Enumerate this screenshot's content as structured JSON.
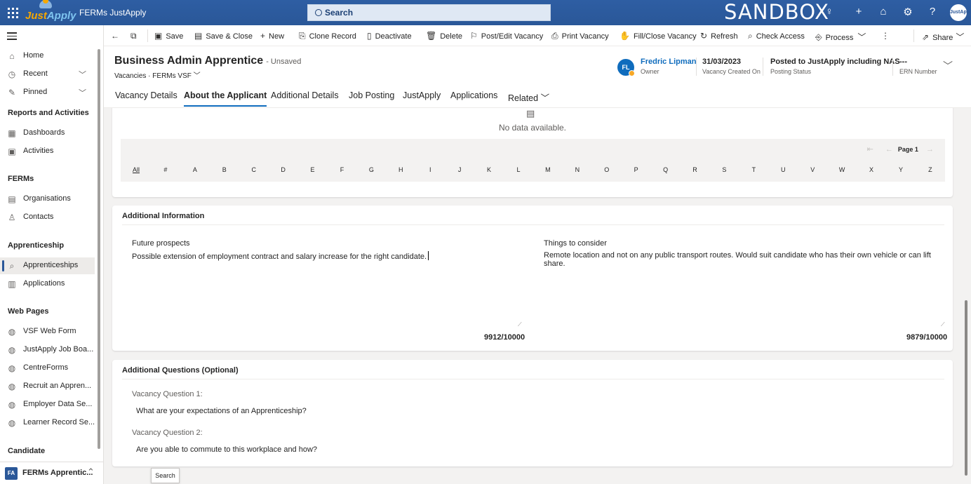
{
  "topbar": {
    "logo_text_main": "Just",
    "logo_text_accent": "Apply",
    "app_name": "FERMs JustApply",
    "search_label": "Search",
    "environment": "SANDBOX",
    "avatar_text": "JustApply"
  },
  "sidebar": {
    "items_top": [
      {
        "label": "Home",
        "icon": "home-icon"
      },
      {
        "label": "Recent",
        "icon": "clock-icon"
      },
      {
        "label": "Pinned",
        "icon": "pin-icon"
      }
    ],
    "section_reports": "Reports and Activities",
    "reports_items": [
      {
        "label": "Dashboards",
        "icon": "dashboard-icon"
      },
      {
        "label": "Activities",
        "icon": "activities-icon"
      }
    ],
    "section_ferms": "FERMs",
    "ferms_items": [
      {
        "label": "Organisations",
        "icon": "organisation-icon"
      },
      {
        "label": "Contacts",
        "icon": "contact-icon"
      }
    ],
    "section_apprenticeship": "Apprenticeship",
    "apprenticeship_items": [
      {
        "label": "Apprenticeships",
        "icon": "search-doc-icon"
      },
      {
        "label": "Applications",
        "icon": "form-icon"
      }
    ],
    "section_web": "Web Pages",
    "web_items": [
      {
        "label": "VSF Web Form"
      },
      {
        "label": "JustApply Job Boa..."
      },
      {
        "label": "CentreForms"
      },
      {
        "label": "Recruit an Appren..."
      },
      {
        "label": "Employer Data Se..."
      },
      {
        "label": "Learner Record Se..."
      }
    ],
    "section_candidate": "Candidate",
    "area_badge": "FA",
    "area_label": "FERMs Apprentic..."
  },
  "commands": {
    "save": "Save",
    "save_close": "Save & Close",
    "new": "New",
    "clone": "Clone Record",
    "deactivate": "Deactivate",
    "delete": "Delete",
    "post_edit": "Post/Edit Vacancy",
    "print": "Print Vacancy",
    "fill_close": "Fill/Close Vacancy",
    "refresh": "Refresh",
    "check_access": "Check Access",
    "process": "Process",
    "share": "Share"
  },
  "header": {
    "title": "Business Admin Apprentice",
    "status": "- Unsaved",
    "entity": "Vacancies",
    "form": "FERMs VSF",
    "owner_initials": "FL",
    "owner_name": "Fredric Lipman",
    "owner_label": "Owner",
    "created_value": "31/03/2023",
    "created_label": "Vacancy Created On",
    "posting_value": "Posted to JustApply including NAS",
    "posting_label": "Posting Status",
    "ern_value": "---",
    "ern_label": "ERN Number"
  },
  "tabs": [
    {
      "label": "Vacancy Details"
    },
    {
      "label": "About the Applicant"
    },
    {
      "label": "Additional Details"
    },
    {
      "label": "Job Posting"
    },
    {
      "label": "JustApply"
    },
    {
      "label": "Applications"
    },
    {
      "label": "Related"
    }
  ],
  "grid": {
    "empty_text": "No data available.",
    "page_label": "Page 1",
    "alphabet": [
      "All",
      "#",
      "A",
      "B",
      "C",
      "D",
      "E",
      "F",
      "G",
      "H",
      "I",
      "J",
      "K",
      "L",
      "M",
      "N",
      "O",
      "P",
      "Q",
      "R",
      "S",
      "T",
      "U",
      "V",
      "W",
      "X",
      "Y",
      "Z"
    ]
  },
  "additional_info": {
    "title": "Additional Information",
    "future_label": "Future prospects",
    "future_value": "Possible extension of employment contract and salary increase for the right candidate.",
    "future_counter": "9912/10000",
    "consider_label": "Things to consider",
    "consider_value": "Remote location and not on any public transport routes. Would suit candidate who has their own vehicle or can lift share.",
    "consider_counter": "9879/10000"
  },
  "additional_questions": {
    "title": "Additional Questions (Optional)",
    "q1_label": "Vacancy Question 1:",
    "q1_value": "What are your expectations of an Apprenticeship?",
    "q2_label": "Vacancy Question 2:",
    "q2_value": "Are you able to commute to this workplace and how?"
  },
  "tooltip": "Search"
}
